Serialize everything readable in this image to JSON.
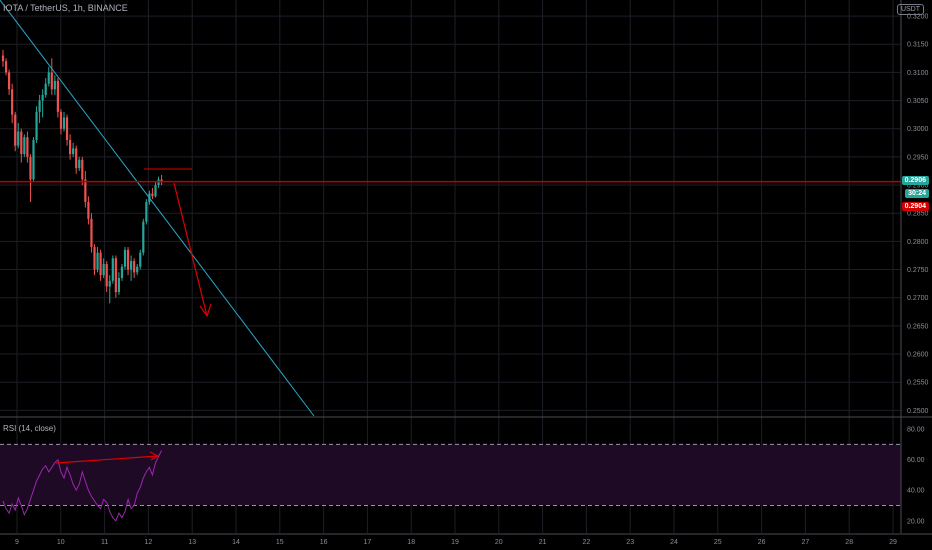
{
  "header": {
    "symbol": "IOTA / TetherUS, 1h, BINANCE"
  },
  "unit_badge": "USDT",
  "price_tags": {
    "last_price": "0.2906",
    "countdown": "30:24",
    "bid_price": "0.2904"
  },
  "colors": {
    "up": "#26a69a",
    "down": "#ef5350",
    "trendline": "#2aa7c9",
    "drawn": "#e00000",
    "rsi_line": "#9c27b0",
    "rsi_band": "#1f0a26",
    "last_price_bg": "#26a69a",
    "bid_price_bg": "#d00000"
  },
  "rsi": {
    "title": "RSI (14, close)",
    "levels": [
      70,
      30
    ],
    "y_ticks": [
      "80.00",
      "60.00",
      "40.00",
      "20.00"
    ],
    "values": [
      33,
      28,
      25,
      31,
      27,
      35,
      30,
      24,
      28,
      34,
      40,
      46,
      50,
      54,
      56,
      52,
      55,
      58,
      60,
      52,
      48,
      55,
      50,
      44,
      40,
      44,
      52,
      46,
      40,
      36,
      33,
      30,
      28,
      34,
      32,
      26,
      22,
      20,
      25,
      22,
      26,
      34,
      28,
      30,
      38,
      42,
      48,
      52,
      55,
      50,
      58,
      62,
      66
    ]
  },
  "chart_data": {
    "type": "candlestick",
    "title": "IOTA / TetherUS, 1h, BINANCE",
    "ylim": [
      0.249,
      0.3225
    ],
    "y_ticks": [
      "0.3200",
      "0.3150",
      "0.3100",
      "0.3050",
      "0.3000",
      "0.2950",
      "0.2900",
      "0.2850",
      "0.2800",
      "0.2750",
      "0.2700",
      "0.2650",
      "0.2600",
      "0.2550",
      "0.2500"
    ],
    "x_ticks": [
      "9",
      "10",
      "11",
      "12",
      "13",
      "14",
      "15",
      "16",
      "17",
      "18",
      "19",
      "20",
      "21",
      "22",
      "23",
      "24",
      "25",
      "26",
      "27",
      "28",
      "29"
    ],
    "last_price": 0.2906,
    "candles": [
      [
        0.313,
        0.314,
        0.311,
        0.312
      ],
      [
        0.312,
        0.3125,
        0.3095,
        0.31
      ],
      [
        0.31,
        0.3105,
        0.306,
        0.307
      ],
      [
        0.307,
        0.308,
        0.301,
        0.3025
      ],
      [
        0.3025,
        0.303,
        0.296,
        0.297
      ],
      [
        0.297,
        0.301,
        0.2965,
        0.2995
      ],
      [
        0.2995,
        0.3,
        0.294,
        0.2955
      ],
      [
        0.2955,
        0.299,
        0.295,
        0.2985
      ],
      [
        0.2985,
        0.2995,
        0.294,
        0.295
      ],
      [
        0.295,
        0.2955,
        0.287,
        0.291
      ],
      [
        0.291,
        0.2985,
        0.2905,
        0.298
      ],
      [
        0.298,
        0.304,
        0.2975,
        0.303
      ],
      [
        0.303,
        0.306,
        0.301,
        0.305
      ],
      [
        0.305,
        0.307,
        0.302,
        0.306
      ],
      [
        0.306,
        0.309,
        0.3055,
        0.308
      ],
      [
        0.308,
        0.311,
        0.3075,
        0.31
      ],
      [
        0.31,
        0.3125,
        0.306,
        0.307
      ],
      [
        0.307,
        0.3095,
        0.306,
        0.3085
      ],
      [
        0.3085,
        0.309,
        0.302,
        0.303
      ],
      [
        0.303,
        0.3035,
        0.299,
        0.3
      ],
      [
        0.3,
        0.303,
        0.2995,
        0.302
      ],
      [
        0.302,
        0.3025,
        0.297,
        0.298
      ],
      [
        0.298,
        0.299,
        0.2945,
        0.2955
      ],
      [
        0.2955,
        0.2975,
        0.295,
        0.2965
      ],
      [
        0.2965,
        0.297,
        0.292,
        0.293
      ],
      [
        0.293,
        0.295,
        0.2925,
        0.2945
      ],
      [
        0.2945,
        0.295,
        0.29,
        0.291
      ],
      [
        0.291,
        0.2925,
        0.286,
        0.287
      ],
      [
        0.287,
        0.288,
        0.283,
        0.284
      ],
      [
        0.284,
        0.285,
        0.278,
        0.279
      ],
      [
        0.279,
        0.2795,
        0.274,
        0.275
      ],
      [
        0.275,
        0.279,
        0.2745,
        0.278
      ],
      [
        0.278,
        0.2785,
        0.273,
        0.274
      ],
      [
        0.274,
        0.277,
        0.2735,
        0.276
      ],
      [
        0.276,
        0.2765,
        0.271,
        0.272
      ],
      [
        0.272,
        0.274,
        0.269,
        0.273
      ],
      [
        0.273,
        0.2775,
        0.2725,
        0.277
      ],
      [
        0.277,
        0.2775,
        0.27,
        0.271
      ],
      [
        0.271,
        0.2745,
        0.2705,
        0.2735
      ],
      [
        0.2735,
        0.276,
        0.273,
        0.2755
      ],
      [
        0.2755,
        0.279,
        0.275,
        0.2785
      ],
      [
        0.2785,
        0.279,
        0.274,
        0.275
      ],
      [
        0.275,
        0.2775,
        0.273,
        0.2765
      ],
      [
        0.2765,
        0.277,
        0.2735,
        0.2745
      ],
      [
        0.2745,
        0.276,
        0.274,
        0.2755
      ],
      [
        0.2755,
        0.2785,
        0.275,
        0.278
      ],
      [
        0.278,
        0.284,
        0.2775,
        0.2835
      ],
      [
        0.2835,
        0.2875,
        0.283,
        0.287
      ],
      [
        0.287,
        0.289,
        0.2865,
        0.2885
      ],
      [
        0.2885,
        0.2895,
        0.2875,
        0.288
      ],
      [
        0.288,
        0.2905,
        0.2878,
        0.29
      ],
      [
        0.29,
        0.2915,
        0.2895,
        0.291
      ],
      [
        0.291,
        0.2918,
        0.29,
        0.2906
      ]
    ]
  }
}
